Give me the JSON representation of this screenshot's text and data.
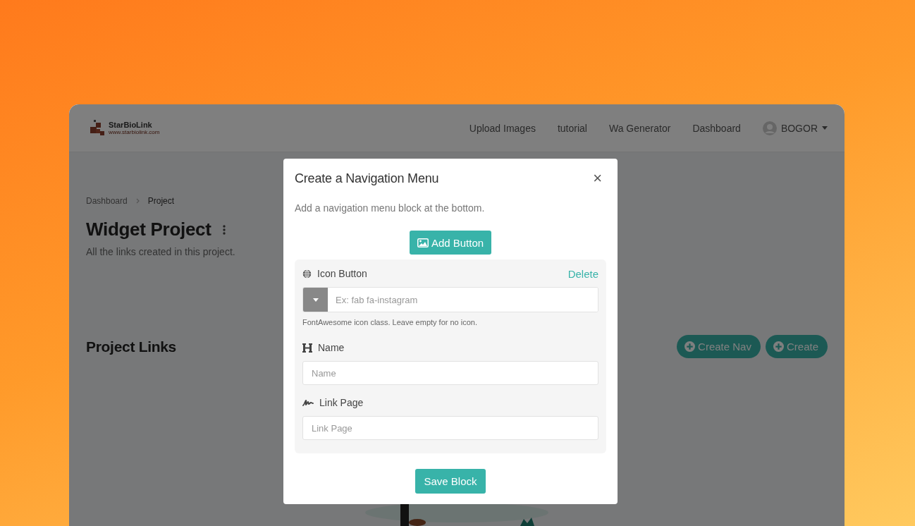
{
  "logo": {
    "name": "StarBioLink",
    "url": "www.starbiolink.com"
  },
  "nav": {
    "links": [
      "Upload Images",
      "tutorial",
      "Wa Generator",
      "Dashboard"
    ],
    "user": "BOGOR"
  },
  "breadcrumb": [
    {
      "label": "Dashboard",
      "current": false
    },
    {
      "label": "Project",
      "current": true
    }
  ],
  "page": {
    "title": "Widget Project",
    "subtitle": "All the links created in this project."
  },
  "section": {
    "title": "Project Links",
    "buttons": [
      "Create Nav",
      "Create"
    ]
  },
  "modal": {
    "title": "Create a Navigation Menu",
    "close": "×",
    "description": "Add a navigation menu block at the bottom.",
    "add_button": "Add Button",
    "block": {
      "delete": "Delete",
      "fields": [
        {
          "kind": "icon",
          "label": "Icon Button",
          "placeholder": "Ex: fab fa-instagram",
          "help": "FontAwesome icon class. Leave empty for no icon."
        },
        {
          "kind": "text",
          "label": "Name",
          "placeholder": "Name"
        },
        {
          "kind": "link",
          "label": "Link Page",
          "placeholder": "Link Page"
        }
      ]
    },
    "save": "Save Block"
  }
}
